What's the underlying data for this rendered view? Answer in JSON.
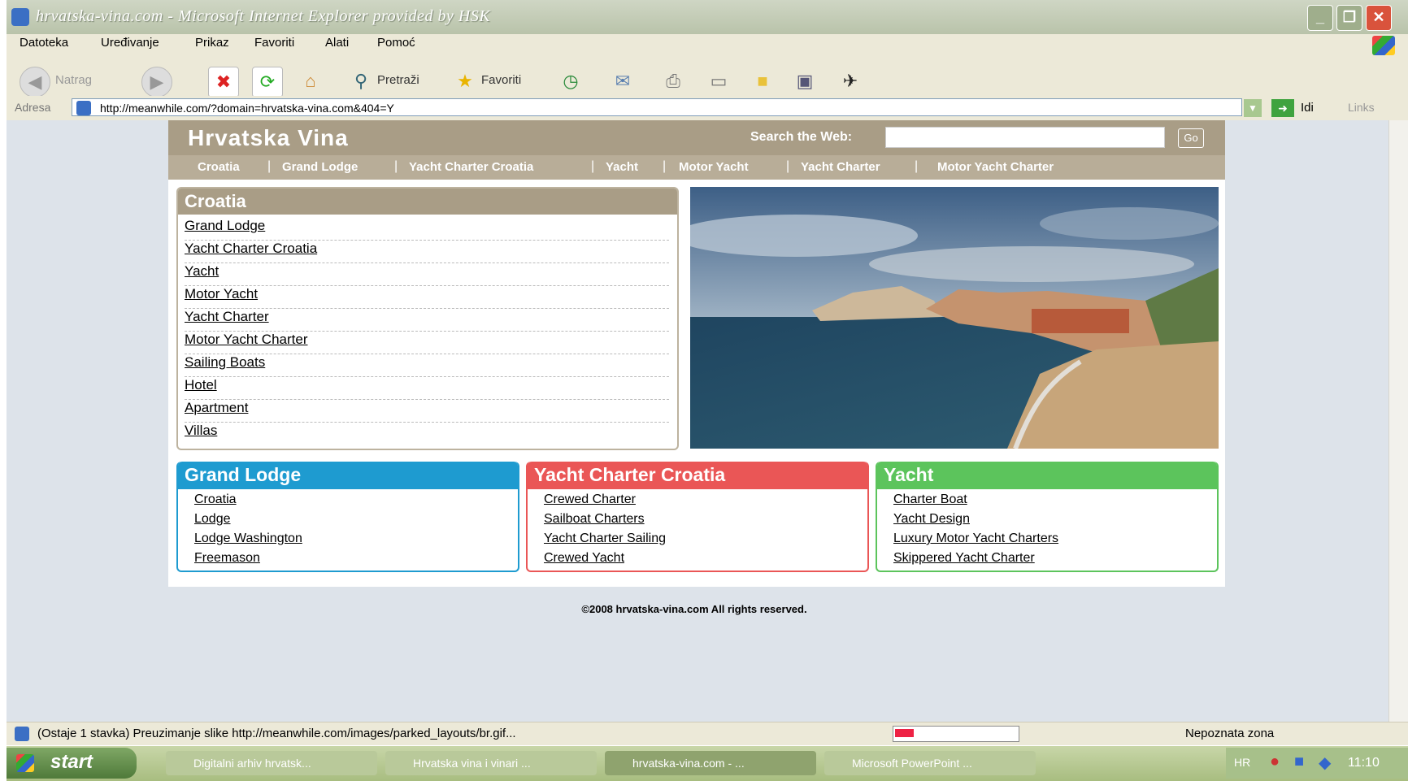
{
  "window": {
    "title": "hrvatska-vina.com - Microsoft Internet Explorer provided by HSK",
    "minimize": "_",
    "maximize": "❐",
    "close": "✕"
  },
  "menu": [
    "Datoteka",
    "Uređivanje",
    "Prikaz",
    "Favoriti",
    "Alati",
    "Pomoć"
  ],
  "toolbar": {
    "back": "Natrag",
    "search": "Pretraži",
    "favorites": "Favoriti"
  },
  "address": {
    "label": "Adresa",
    "url": "http://meanwhile.com/?domain=hrvatska-vina.com&404=Y",
    "go": "Idi",
    "links": "Links"
  },
  "site": {
    "title": "Hrvatska Vina",
    "search_label": "Search the Web:",
    "search_go": "Go",
    "nav": [
      "Croatia",
      "Grand Lodge",
      "Yacht Charter Croatia",
      "Yacht",
      "Motor Yacht",
      "Yacht Charter",
      "Motor Yacht Charter"
    ],
    "croatia": {
      "title": "Croatia",
      "links": [
        "Grand Lodge",
        "Yacht Charter Croatia",
        "Yacht",
        "Motor Yacht",
        "Yacht Charter",
        "Motor Yacht Charter",
        "Sailing Boats",
        "Hotel",
        "Apartment",
        "Villas"
      ]
    },
    "boxes": [
      {
        "title": "Grand Lodge",
        "color": "#1e9bd0",
        "links": [
          "Croatia",
          "Lodge",
          "Lodge Washington",
          "Freemason"
        ]
      },
      {
        "title": "Yacht Charter Croatia",
        "color": "#ea5656",
        "links": [
          "Crewed Charter",
          "Sailboat Charters",
          "Yacht Charter Sailing",
          "Crewed Yacht"
        ]
      },
      {
        "title": "Yacht",
        "color": "#5cc45c",
        "links": [
          "Charter Boat",
          "Yacht Design",
          "Luxury Motor Yacht Charters",
          "Skippered Yacht Charter"
        ]
      }
    ],
    "footer": "©2008 hrvatska-vina.com All rights reserved."
  },
  "status": {
    "text": "(Ostaje 1 stavka) Preuzimanje slike http://meanwhile.com/images/parked_layouts/br.gif...",
    "zone": "Nepoznata zona",
    "progress": 0.15
  },
  "taskbar": {
    "start": "start",
    "items": [
      "Digitalni arhiv hrvatsk...",
      "Hrvatska vina i vinari ...",
      "hrvatska-vina.com - ...",
      "Microsoft PowerPoint ..."
    ],
    "clock": "11:10"
  },
  "colors": {
    "header": "#a99d86",
    "nav": "#b8ad98"
  }
}
